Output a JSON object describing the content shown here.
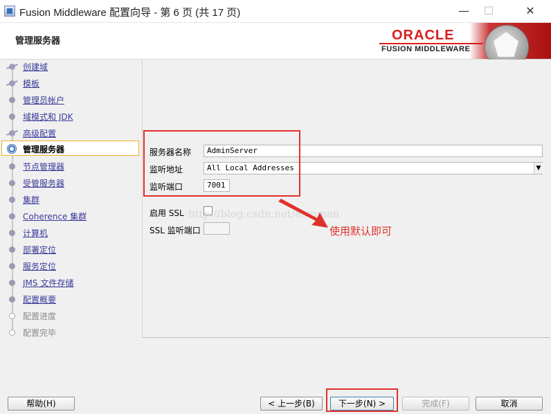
{
  "window": {
    "title": "Fusion Middleware 配置向导 - 第 6 页 (共 17 页)",
    "min": "—",
    "max": "☐",
    "close": "✕"
  },
  "header": {
    "heading": "管理服务器",
    "oracle": "ORACLE",
    "fmw": "FUSION MIDDLEWARE"
  },
  "steps": [
    {
      "label": "创建域",
      "state": "done"
    },
    {
      "label": "模板",
      "state": "done"
    },
    {
      "label": "管理员帐户",
      "state": "done"
    },
    {
      "label": "域模式和 JDK",
      "state": "done"
    },
    {
      "label": "高级配置",
      "state": "done"
    },
    {
      "label": "管理服务器",
      "state": "current"
    },
    {
      "label": "节点管理器",
      "state": "pending"
    },
    {
      "label": "受管服务器",
      "state": "pending"
    },
    {
      "label": "集群",
      "state": "pending"
    },
    {
      "label": "Coherence 集群",
      "state": "pending"
    },
    {
      "label": "计算机",
      "state": "pending"
    },
    {
      "label": "部署定位",
      "state": "pending"
    },
    {
      "label": "服务定位",
      "state": "pending"
    },
    {
      "label": "JMS 文件存储",
      "state": "pending"
    },
    {
      "label": "配置概要",
      "state": "pending"
    },
    {
      "label": "配置进度",
      "state": "disabled"
    },
    {
      "label": "配置完毕",
      "state": "disabled"
    }
  ],
  "form": {
    "server_name_label": "服务器名称",
    "server_name_value": "AdminServer",
    "listen_address_label": "监听地址",
    "listen_address_value": "All Local Addresses",
    "listen_port_label": "监听端口",
    "listen_port_value": "7001",
    "enable_ssl_label": "启用 SSL",
    "ssl_port_label": "SSL 监听端口"
  },
  "annotation": {
    "text": "使用默认即可",
    "watermark": "http://blog.csdn.net/acmman"
  },
  "buttons": {
    "help": "帮助(H)",
    "back": "< 上一步(B)",
    "next": "下一步(N) >",
    "finish": "完成(F)",
    "cancel": "取消"
  },
  "colors": {
    "annotation_red": "#e0302a",
    "oracle_red": "#d8201d",
    "link": "#3a3a9a",
    "current_highlight": "#f0b020"
  }
}
